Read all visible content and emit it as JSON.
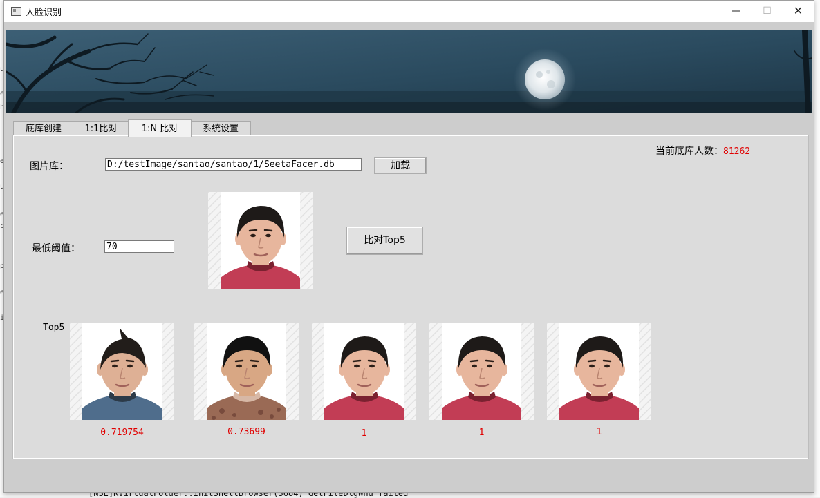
{
  "window": {
    "title": "人脸识别",
    "controls": {
      "minimize": "—",
      "maximize": "☐",
      "close": "✕"
    }
  },
  "tabs": [
    {
      "label": "底库创建",
      "active": false
    },
    {
      "label": "1:1比对",
      "active": false
    },
    {
      "label": "1:N 比对",
      "active": true
    },
    {
      "label": "系统设置",
      "active": false
    }
  ],
  "panel": {
    "db_count_label": "当前底库人数：",
    "db_count_value": "81262",
    "gallery_label": "图片库：",
    "gallery_path": "D:/testImage/santao/santao/1/SeetaFacer.db",
    "load_button": "加载",
    "threshold_label": "最低阈值：",
    "threshold_value": "70",
    "compare_button": "比对Top5",
    "top5_label": "Top5",
    "results": [
      {
        "score": "0.719754",
        "face": "face-spiky-blue"
      },
      {
        "score": "0.73699",
        "face": "face-patterned-shirt"
      },
      {
        "score": "1",
        "face": "face-query-match"
      },
      {
        "score": "1",
        "face": "face-query-match"
      },
      {
        "score": "1",
        "face": "face-query-match"
      }
    ]
  },
  "background": {
    "console_line": "[NSE]KVirtualFolder::InitShellBrowser(3684) GetFileDlgWnd failed"
  },
  "colors": {
    "accent_red": "#e00000",
    "panel_bg": "#dcdcdc",
    "banner_sky": "#2b4a5e"
  }
}
